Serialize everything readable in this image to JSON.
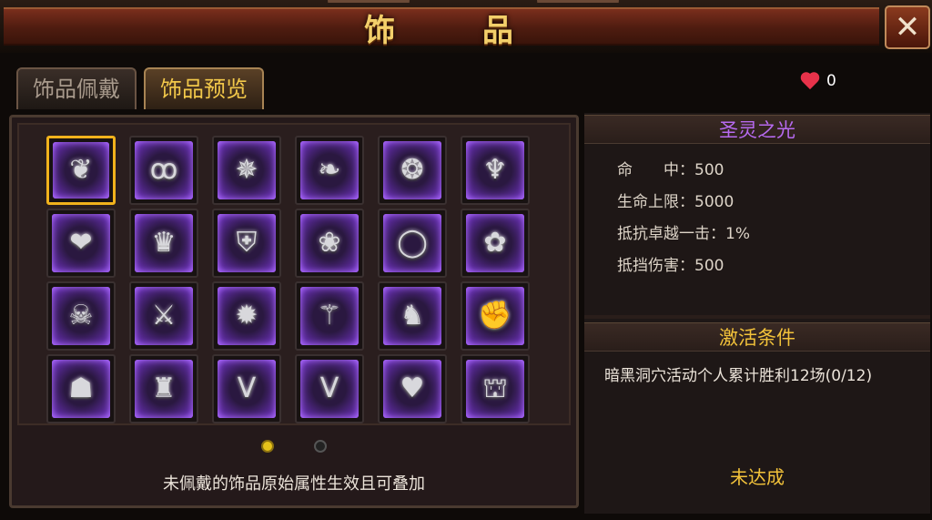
{
  "title": "饰 品",
  "close_icon": "close-x-icon",
  "tabs": [
    {
      "label": "饰品佩戴",
      "active": false
    },
    {
      "label": "饰品预览",
      "active": true
    }
  ],
  "currency": {
    "icon": "heart-icon",
    "value": "0"
  },
  "grid": {
    "slots": [
      {
        "icon": "pendant-icon",
        "glyph": "❦",
        "selected": true
      },
      {
        "icon": "earrings-icon",
        "glyph": "ꝏ"
      },
      {
        "icon": "star-medallion-icon",
        "glyph": "✵"
      },
      {
        "icon": "winged-pendant-icon",
        "glyph": "❧"
      },
      {
        "icon": "thorn-ring-icon",
        "glyph": "❂"
      },
      {
        "icon": "chalice-icon",
        "glyph": "♆"
      },
      {
        "icon": "heart-amulet-icon",
        "glyph": "❤"
      },
      {
        "icon": "crown-icon",
        "glyph": "♛"
      },
      {
        "icon": "shield-crest-icon",
        "glyph": "⛨"
      },
      {
        "icon": "feather-charm-icon",
        "glyph": "❀"
      },
      {
        "icon": "ring-icon",
        "glyph": "◯"
      },
      {
        "icon": "flower-pendant-icon",
        "glyph": "✿"
      },
      {
        "icon": "demon-mask-icon",
        "glyph": "☠"
      },
      {
        "icon": "blade-charm-icon",
        "glyph": "⚔"
      },
      {
        "icon": "spiked-orb-icon",
        "glyph": "✹"
      },
      {
        "icon": "scepter-icon",
        "glyph": "⚚"
      },
      {
        "icon": "bird-pendant-icon",
        "glyph": "♞"
      },
      {
        "icon": "gauntlet-icon",
        "glyph": "✊"
      },
      {
        "icon": "hood-icon",
        "glyph": "☗"
      },
      {
        "icon": "dragon-head-icon",
        "glyph": "♜"
      },
      {
        "icon": "v-emblem-icon",
        "glyph": "Ⅴ"
      },
      {
        "icon": "v-crest-icon",
        "glyph": "Ⅴ"
      },
      {
        "icon": "dark-heart-icon",
        "glyph": "♥"
      },
      {
        "icon": "armored-helm-icon",
        "glyph": "⛫"
      }
    ]
  },
  "pager": {
    "pages": 2,
    "current": 1
  },
  "note": "未佩戴的饰品原始属性生效且可叠加",
  "detail": {
    "name": "圣灵之光",
    "stats": [
      {
        "label": "命　　中：",
        "value": "500"
      },
      {
        "label": "生命上限：",
        "value": "5000"
      },
      {
        "label": "抵抗卓越一击：",
        "value": "1%"
      },
      {
        "label": "抵挡伤害：",
        "value": "500"
      }
    ],
    "condition_title": "激活条件",
    "condition_text": "暗黑洞穴活动个人累计胜利12场(0/12)",
    "status": "未达成"
  },
  "colors": {
    "accent_gold": "#f2c23a",
    "item_name_purple": "#b76af0",
    "slot_glow": "#8a4ae0",
    "selected_border": "#f1b21c"
  }
}
